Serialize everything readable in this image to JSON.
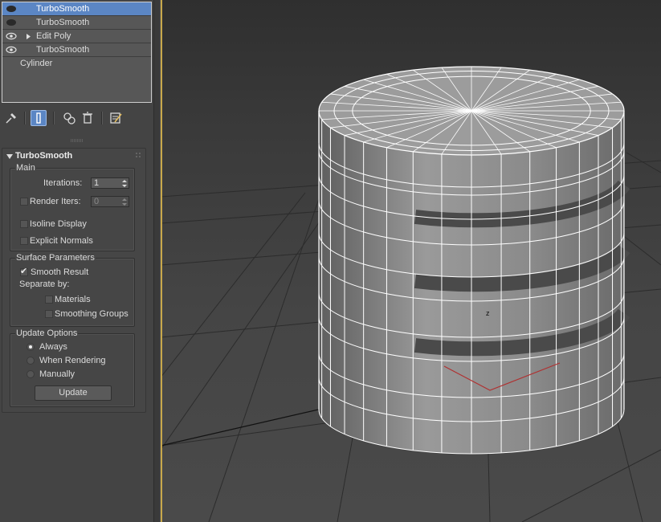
{
  "modifier_stack": {
    "items": [
      {
        "label": "TurboSmooth",
        "selected": true,
        "visible_eye": "eye-off-icon",
        "expandable": false
      },
      {
        "label": "TurboSmooth",
        "selected": false,
        "visible_eye": "eye-off-icon",
        "expandable": false
      },
      {
        "label": "Edit Poly",
        "selected": false,
        "visible_eye": "eye-icon",
        "expandable": true
      },
      {
        "label": "TurboSmooth",
        "selected": false,
        "visible_eye": "eye-icon",
        "expandable": false
      },
      {
        "label": "Cylinder",
        "selected": false,
        "visible_eye": "",
        "expandable": false
      }
    ]
  },
  "toolbar": {
    "tools": [
      "pin-stack-icon",
      "show-end-result-icon",
      "make-unique-icon",
      "remove-modifier-icon",
      "configure-modifier-sets-icon"
    ],
    "active": "show-end-result-icon"
  },
  "rollout": {
    "title": "TurboSmooth",
    "main": {
      "title": "Main",
      "iterations_label": "Iterations:",
      "iterations_value": "1",
      "render_iters_label": "Render Iters:",
      "render_iters_value": "0",
      "render_iters_checked": false,
      "isoline_label": "Isoline Display",
      "isoline_checked": false,
      "explicit_normals_label": "Explicit Normals",
      "explicit_normals_checked": false
    },
    "surface": {
      "title": "Surface Parameters",
      "smooth_result_label": "Smooth Result",
      "smooth_result_checked": true,
      "separate_by_label": "Separate by:",
      "materials_label": "Materials",
      "materials_checked": false,
      "smoothing_groups_label": "Smoothing Groups",
      "smoothing_groups_checked": false
    },
    "update": {
      "title": "Update Options",
      "options": [
        "Always",
        "When Rendering",
        "Manually"
      ],
      "selected": "Always",
      "button_label": "Update"
    }
  },
  "viewport": {
    "gizmo_axis_label": "z",
    "background_color": "#3c3c3c",
    "wire_color": "#ffffff",
    "active_border_color": "#c8a84b",
    "gizmo_color": "#b03030"
  }
}
